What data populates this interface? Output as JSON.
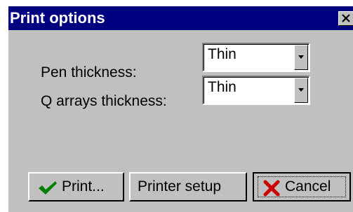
{
  "window": {
    "title": "Print options"
  },
  "fields": {
    "pen_thickness": {
      "label": "Pen thickness:",
      "value": "Thin"
    },
    "q_arrays_thickness": {
      "label": "Q arrays thickness:",
      "value": "Thin"
    }
  },
  "buttons": {
    "print": {
      "label": "Print...",
      "icon": "checkmark-icon",
      "color": "#008000"
    },
    "printer_setup": {
      "label": "Printer setup"
    },
    "cancel": {
      "label": "Cancel",
      "icon": "x-icon",
      "color": "#cc0000"
    }
  }
}
